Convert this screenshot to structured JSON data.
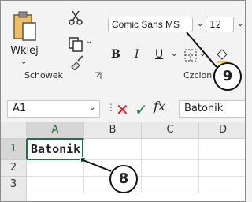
{
  "clipboard": {
    "paste_label": "Wklej",
    "group_label": "Schowek"
  },
  "font": {
    "font_name": "Comic Sans MS",
    "font_size": "12",
    "bold_label": "B",
    "italic_label": "I",
    "underline_label": "U",
    "group_label": "Czcionka"
  },
  "formula_bar": {
    "name_box": "A1",
    "fx_label": "fx",
    "value": "Batonik"
  },
  "grid": {
    "columns": [
      "A",
      "B",
      "C",
      "D"
    ],
    "rows": [
      "1",
      "2",
      "3"
    ],
    "cell_a1": "Batonik"
  },
  "callouts": {
    "font_callout": "9",
    "cell_callout": "8"
  }
}
